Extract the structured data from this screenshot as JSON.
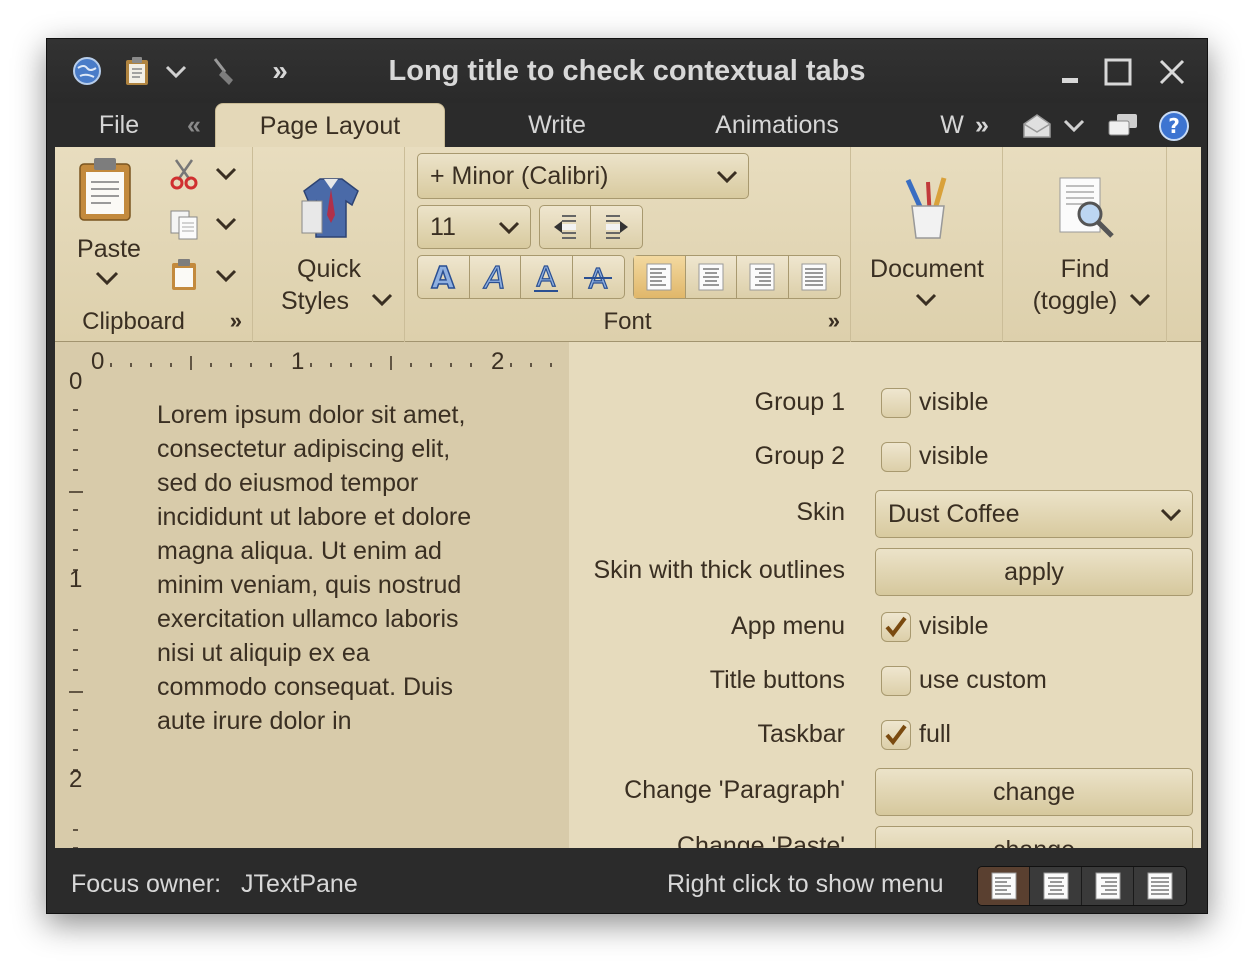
{
  "window": {
    "title": "Long title to check contextual tabs"
  },
  "taskbar": {
    "overflow_label": "»",
    "icons": [
      "globe-icon",
      "clipboard-icon",
      "broom-icon"
    ]
  },
  "tabs": {
    "file": "File",
    "scroll_left": "«",
    "items": [
      "Page Layout",
      "Write",
      "Animations",
      "W"
    ],
    "scroll_right": "»",
    "selected": "Page Layout"
  },
  "ribbon": {
    "clipboard": {
      "paste_label": "Paste",
      "title": "Clipboard",
      "expand": "»"
    },
    "quick_styles": {
      "label_line1": "Quick",
      "label_line2": "Styles"
    },
    "font": {
      "family": "+ Minor (Calibri)",
      "size": "11",
      "title": "Font",
      "expand": "»"
    },
    "document": {
      "label": "Document"
    },
    "find": {
      "label_line1": "Find",
      "label_line2": "(toggle)"
    }
  },
  "editor": {
    "ruler_h": [
      "0",
      "1",
      "2"
    ],
    "ruler_v": [
      "0",
      "1",
      "2"
    ],
    "text": "Lorem ipsum dolor sit amet, consectetur adipiscing elit, sed do eiusmod tempor incididunt ut labore et dolore magna aliqua. Ut enim ad minim veniam, quis nostrud exercitation ullamco laboris nisi ut aliquip ex ea commodo consequat. Duis aute irure dolor in"
  },
  "settings": {
    "group1": {
      "label": "Group 1",
      "option": "visible",
      "checked": false
    },
    "group2": {
      "label": "Group 2",
      "option": "visible",
      "checked": false
    },
    "skin": {
      "label": "Skin",
      "value": "Dust Coffee"
    },
    "thick": {
      "label": "Skin with thick outlines",
      "button": "apply"
    },
    "app_menu": {
      "label": "App menu",
      "option": "visible",
      "checked": true
    },
    "title_buttons": {
      "label": "Title buttons",
      "option": "use custom",
      "checked": false
    },
    "taskbar": {
      "label": "Taskbar",
      "option": "full",
      "checked": true
    },
    "change_paragraph": {
      "label": "Change 'Paragraph'",
      "button": "change"
    },
    "change_paste": {
      "label": "Change 'Paste'",
      "button": "change"
    }
  },
  "status": {
    "focus_label": "Focus owner:",
    "focus_value": "JTextPane",
    "hint": "Right click to show menu"
  },
  "colors": {
    "accent": "#e4d8b8",
    "dark": "#2b2b2b",
    "check": "#7a4a10"
  }
}
